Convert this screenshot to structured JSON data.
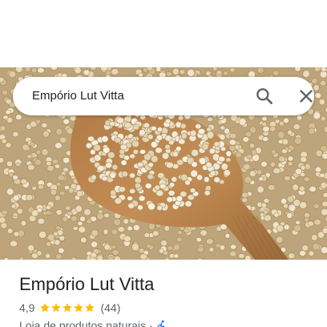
{
  "search": {
    "query": "Empório Lut Vitta",
    "search_icon": "search-icon",
    "close_icon": "close-icon"
  },
  "hero_image": {
    "subject": "quinoa-grains-on-wooden-spoon"
  },
  "place": {
    "name": "Empório Lut Vitta",
    "rating": "4,9",
    "stars": 5,
    "review_count": "(44)",
    "category": "Loja de produtos naturais",
    "separator": "·",
    "accessibility_icon": "wheelchair-icon"
  },
  "colors": {
    "star": "#fbbc04",
    "accessibility": "#1a73e8",
    "text_primary": "#202124",
    "text_secondary": "#5f6368"
  }
}
